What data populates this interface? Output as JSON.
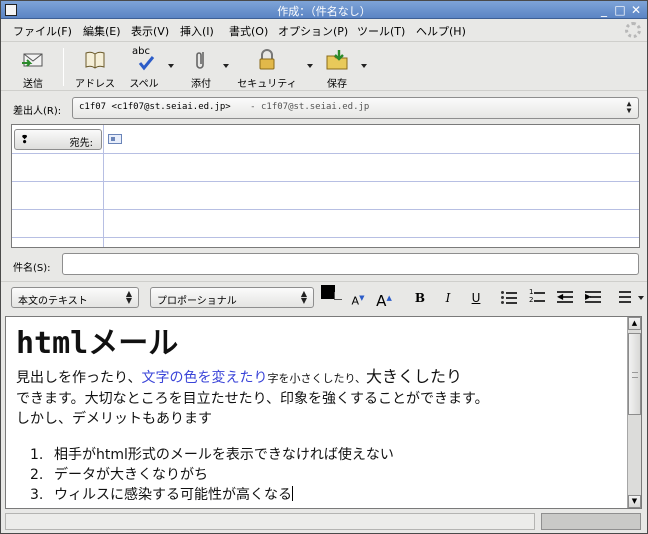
{
  "window": {
    "title": "作成：（件名なし）"
  },
  "menu": [
    {
      "label": "ファイル(F)"
    },
    {
      "label": "編集(E)"
    },
    {
      "label": "表示(V)"
    },
    {
      "label": "挿入(I)"
    },
    {
      "label": "書式(O)"
    },
    {
      "label": "オプション(P)"
    },
    {
      "label": "ツール(T)"
    },
    {
      "label": "ヘルプ(H)"
    }
  ],
  "toolbar": {
    "send": "送信",
    "address": "アドレス",
    "spell": "スペル",
    "spell_glyph": "abc",
    "attach": "添付",
    "security": "セキュリティ",
    "save": "保存"
  },
  "from": {
    "label": "差出人(R):",
    "value": "c1f07 <c1f07@st.seiai.ed.jp>",
    "account": "- c1f07@st.seiai.ed.jp"
  },
  "recipient": {
    "type": "宛先:"
  },
  "subject": {
    "label": "件名(S):",
    "value": ""
  },
  "format": {
    "paragraph_style": "本文のテキスト",
    "font": "プロポーショナル",
    "text_color": "#000000"
  },
  "body": {
    "heading_latin": "html",
    "heading_rest": "メール",
    "line1_a": "見出しを作ったり、",
    "line1_blue": "文字の色を変えたり",
    "line1_small": "字を小さくしたり、",
    "line1_big": "大きくしたり",
    "line2": "できます。大切なところを目立たせたり、印象を強くすることができます。",
    "line3": "しかし、デメリットもあります",
    "list": [
      {
        "num": "1.",
        "text": "相手がhtml形式のメールを表示できなければ使えない"
      },
      {
        "num": "2.",
        "text": "データが大きくなりがち"
      },
      {
        "num": "3.",
        "text": "ウィルスに感染する可能性が高くなる"
      }
    ]
  }
}
